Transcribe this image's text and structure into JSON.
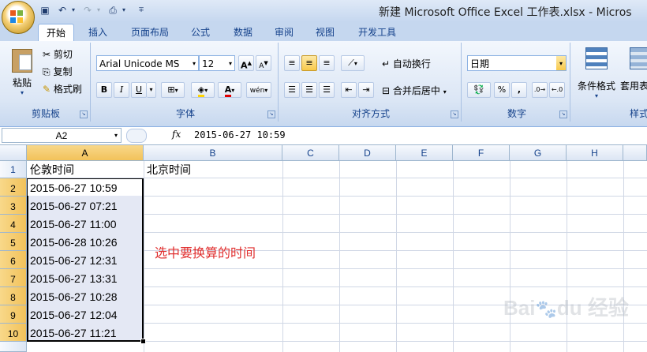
{
  "window": {
    "title": "新建 Microsoft Office Excel 工作表.xlsx - Micros"
  },
  "tabs": [
    "开始",
    "插入",
    "页面布局",
    "公式",
    "数据",
    "审阅",
    "视图",
    "开发工具"
  ],
  "ribbon": {
    "clipboard": {
      "label": "剪贴板",
      "paste": "粘贴",
      "cut": "剪切",
      "copy": "复制",
      "format_painter": "格式刷"
    },
    "font": {
      "label": "字体",
      "font_name": "Arial Unicode MS",
      "font_size": "12",
      "bold": "B",
      "italic": "I",
      "underline": "U",
      "grow": "A",
      "shrink": "A",
      "phonetic": "wén"
    },
    "alignment": {
      "label": "对齐方式",
      "wrap_text": "自动换行",
      "merge_center": "合并后居中"
    },
    "number": {
      "label": "数字",
      "format": "日期"
    },
    "styles": {
      "label": "样式",
      "conditional": "条件格式",
      "format_table": "套用表格格"
    }
  },
  "formula_bar": {
    "name_box": "A2",
    "fx": "fx",
    "formula": "2015-06-27 10:59"
  },
  "sheet": {
    "columns": [
      "A",
      "B",
      "C",
      "D",
      "E",
      "F",
      "G",
      "H"
    ],
    "rows": [
      "1",
      "2",
      "3",
      "4",
      "5",
      "6",
      "7",
      "8",
      "9",
      "10"
    ],
    "header_a": "伦敦时间",
    "header_b": "北京时间",
    "times": [
      "2015-06-27 10:59",
      "2015-06-27 07:21",
      "2015-06-27 11:00",
      "2015-06-28 10:26",
      "2015-06-27 12:31",
      "2015-06-27 13:31",
      "2015-06-27 10:28",
      "2015-06-27 12:04",
      "2015-06-27 11:21"
    ],
    "annotation": "选中要换算的时间",
    "annotation_color": "#e03030"
  },
  "watermark": "Baidu经验 jingyan.baidu.com"
}
